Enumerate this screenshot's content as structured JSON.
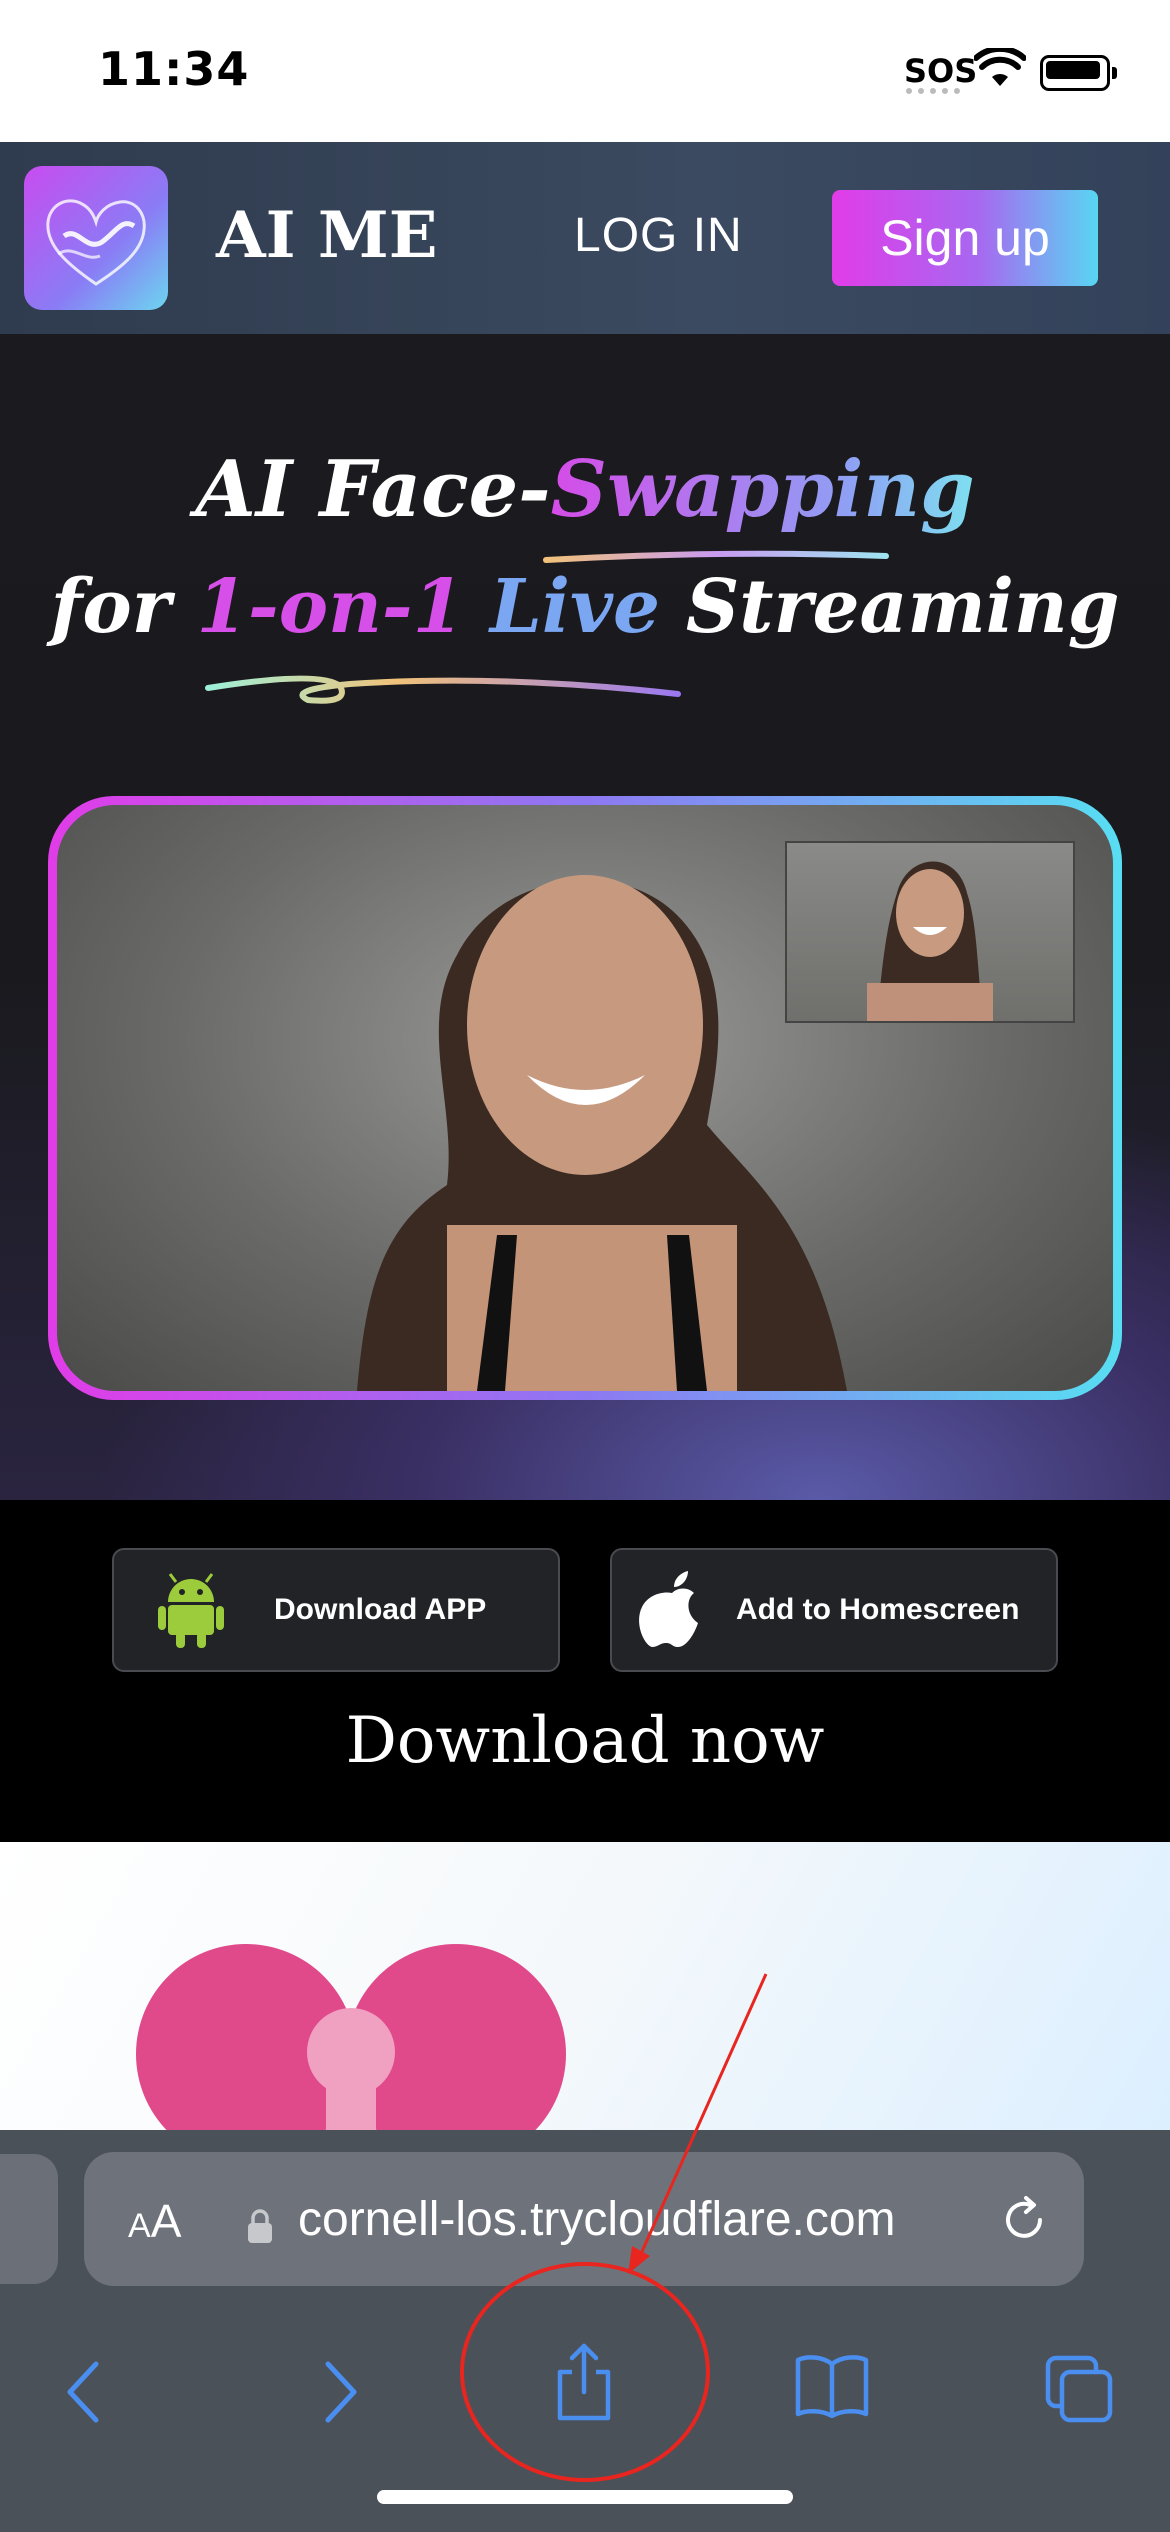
{
  "status_bar": {
    "time": "11:34",
    "sos": "SOS"
  },
  "nav": {
    "brand": "AI ME",
    "login": "LOG IN",
    "signup": "Sign up"
  },
  "hero": {
    "line1_a": "AI Face-",
    "line1_b": "Swapping",
    "line2_a": "for ",
    "line2_b": "1-on-1",
    "line2_c": " Live",
    "line2_d": " Streaming"
  },
  "download": {
    "android_label": "Download APP",
    "ios_label": "Add to Homescreen",
    "title": "Download now"
  },
  "browser": {
    "aa_label_small": "A",
    "aa_label_big": "A",
    "url": "cornell-los.trycloudflare.com"
  },
  "colors": {
    "accent_pink": "#e13ce8",
    "accent_cyan": "#58def2",
    "safari_blue": "#4a8ef0",
    "annotation_red": "#e8251f"
  }
}
